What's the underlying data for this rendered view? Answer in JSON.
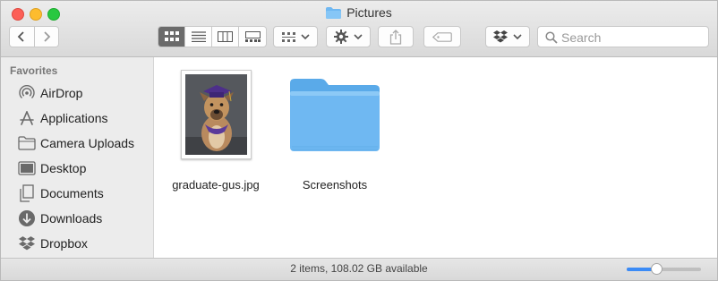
{
  "window": {
    "title": "Pictures",
    "status": "2 items, 108.02 GB available",
    "icon_size_slider": 0.4
  },
  "toolbar": {
    "search_placeholder": "Search",
    "view_modes": [
      "icon-view-icon",
      "list-view-icon",
      "column-view-icon",
      "gallery-view-icon"
    ],
    "active_view": "icon-view-icon"
  },
  "sidebar": {
    "header": "Favorites",
    "items": [
      {
        "label": "AirDrop",
        "icon": "airdrop-icon"
      },
      {
        "label": "Applications",
        "icon": "applications-icon"
      },
      {
        "label": "Camera Uploads",
        "icon": "folder-icon"
      },
      {
        "label": "Desktop",
        "icon": "desktop-icon"
      },
      {
        "label": "Documents",
        "icon": "documents-icon"
      },
      {
        "label": "Downloads",
        "icon": "downloads-icon"
      },
      {
        "label": "Dropbox",
        "icon": "dropbox-icon"
      }
    ]
  },
  "files": [
    {
      "name": "graduate-gus.jpg",
      "type": "image"
    },
    {
      "name": "Screenshots",
      "type": "folder"
    }
  ],
  "colors": {
    "accent": "#3b8bf6",
    "folder": "#6fb8f2",
    "sidebar_bg": "#ececec"
  }
}
